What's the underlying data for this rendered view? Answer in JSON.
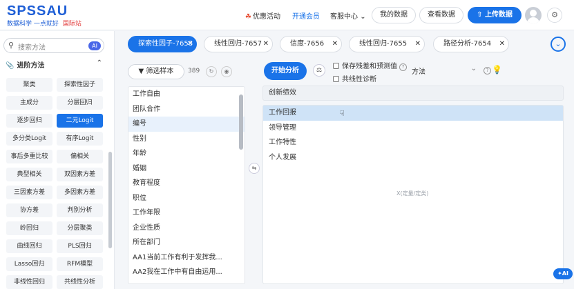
{
  "brand": {
    "name": "SPSSAU",
    "tagline": "数据科学 一点就好",
    "intl": "国际站"
  },
  "topnav": {
    "promo": "优惠活动",
    "vip": "开通会员",
    "client": "客服中心",
    "mydata": "我的数据",
    "viewdata": "查看数据",
    "upload": "上传数据"
  },
  "sidebar": {
    "search_placeholder": "搜索方法",
    "ai_badge": "AI",
    "category": "进阶方法",
    "methods": [
      "聚类",
      "探索性因子",
      "主成分",
      "分层回归",
      "逐步回归",
      "二元Logit",
      "多分类Logit",
      "有序Logit",
      "事后多重比较",
      "偏相关",
      "典型相关",
      "双因素方差",
      "三因素方差",
      "多因素方差",
      "协方差",
      "判别分析",
      "岭回归",
      "分层聚类",
      "曲线回归",
      "PLS回归",
      "Lasso回归",
      "RFM模型",
      "非线性回归",
      "共线性分析"
    ]
  },
  "tabs": [
    {
      "label": "探索性因子-7658"
    },
    {
      "label": "线性回归-7657"
    },
    {
      "label": "信度-7656"
    },
    {
      "label": "线性回归-7655"
    },
    {
      "label": "路径分析-7654"
    }
  ],
  "variables": {
    "filter_label": "筛选样本",
    "count": "389",
    "items": [
      "工作自由",
      "团队合作",
      "编号",
      "性别",
      "年龄",
      "婚姻",
      "教育程度",
      "职位",
      "工作年限",
      "企业性质",
      "所在部门",
      "AA1当前工作有利于发挥我...",
      "AA2我在工作中有自由运用..."
    ]
  },
  "analysis": {
    "run_label": "开始分析",
    "save_label": "保存残差和预测值",
    "collin_label": "共线性诊断",
    "method_label": "方法",
    "dependent": "创新绩效",
    "independents": [
      "工作回报",
      "领导管理",
      "工作特性",
      "个人发展"
    ],
    "independent_placeholder": "X(定量/定类)"
  },
  "ai_float": "AI"
}
